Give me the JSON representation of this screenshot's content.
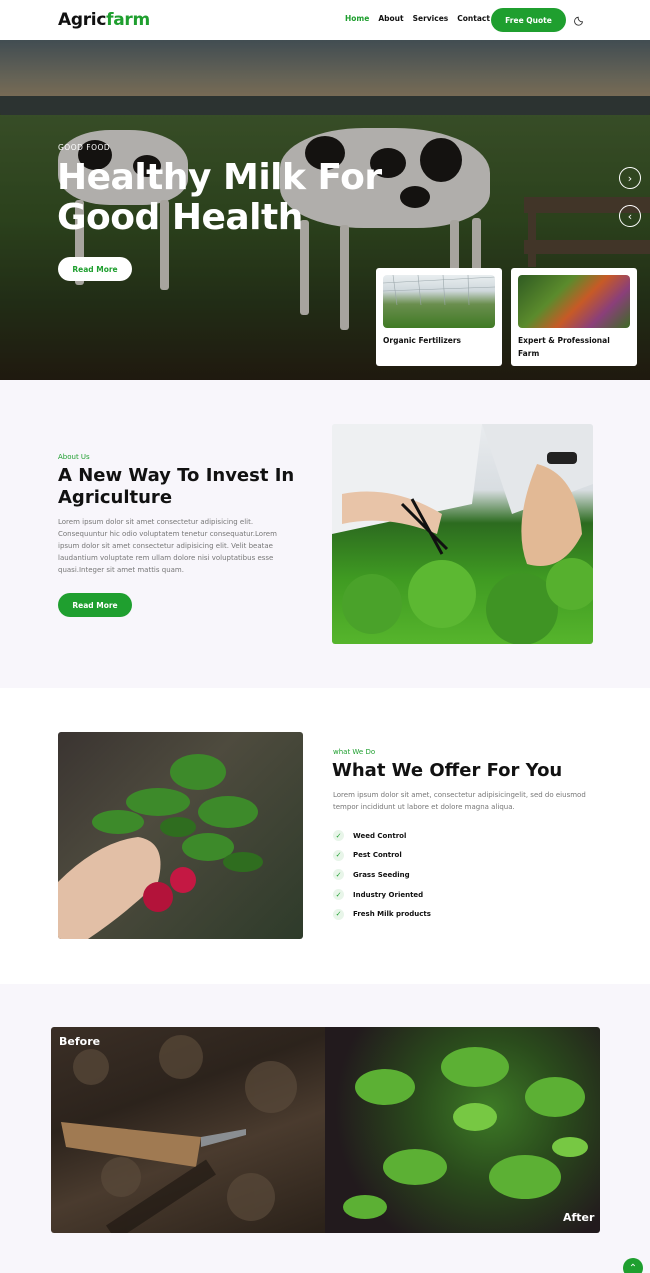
{
  "header": {
    "logo_part1": "Agric",
    "logo_part2": "farm",
    "nav": [
      "Home",
      "About",
      "Services",
      "Contact"
    ],
    "active_nav": "Home",
    "cta_label": "Free Quote",
    "theme_icon": "moon-icon"
  },
  "hero": {
    "tagline": "GOOD FOOD",
    "title": "Healthy Milk For Good Health",
    "button_label": "Read More",
    "next_icon": "chevron-right-icon",
    "prev_icon": "chevron-left-icon",
    "cards": [
      {
        "label": "Organic Fertilizers"
      },
      {
        "label": "Expert & Professional Farm"
      }
    ]
  },
  "about": {
    "eyebrow": "About Us",
    "title": "A New Way To Invest In Agriculture",
    "text": "Lorem ipsum dolor sit amet consectetur adipisicing elit. Consequuntur hic odio voluptatem tenetur consequatur.Lorem ipsum dolor sit amet consectetur adipisicing elit. Velit beatae laudantium voluptate rem ullam dolore nisi voluptatibus esse quasi.Integer sit amet mattis quam.",
    "button_label": "Read More"
  },
  "offer": {
    "eyebrow": "what We Do",
    "title": "What We Offer For You",
    "text": "Lorem ipsum dolor sit amet, consectetur adipisicingelit, sed do eiusmod tempor incididunt ut labore et dolore magna aliqua.",
    "items": [
      "Weed Control",
      "Pest Control",
      "Grass Seeding",
      "Industry Oriented",
      "Fresh Milk products"
    ]
  },
  "compare": {
    "before_label": "Before",
    "after_label": "After"
  },
  "colors": {
    "brand_green": "#1f9f2f",
    "section_bg": "#f8f6fb"
  }
}
